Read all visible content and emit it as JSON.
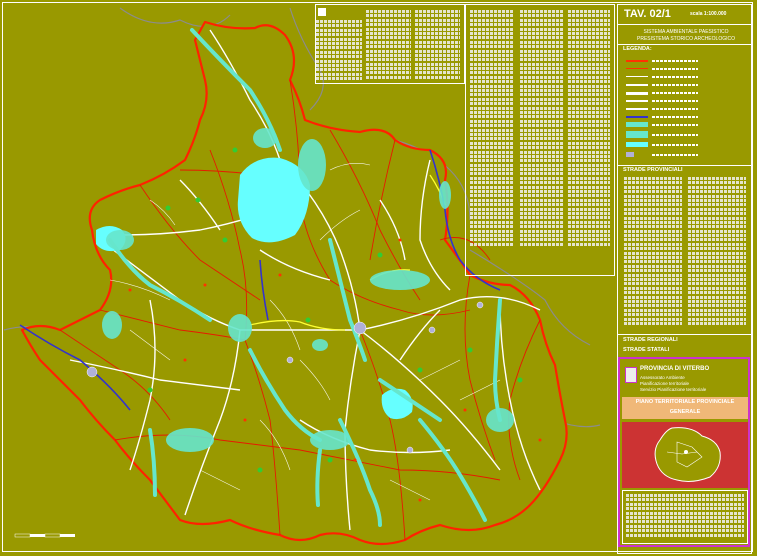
{
  "tav": "TAV. 02/1",
  "scala": "scala 1:100.000",
  "subtitle1": "SISTEMA AMBIENTALE PAESISTICO",
  "subtitle2": "PRESISTEMA STORICO ARCHEOLOGICO",
  "legenda": "LEGENDA:",
  "strade_provinciali": "STRADE PROVINCIALI",
  "strade_regionali": "STRADE REGIONALI",
  "strade_statali": "STRADE STATALI",
  "provincia": "PROVINCIA DI VITERBO",
  "provincia_sub1": "Assessorato Ambiente",
  "provincia_sub2": "Pianificazione territoriale",
  "provincia_sub3": "Servizio Pianificazione territoriale",
  "piano1": "PIANO TERRITORIALE PROVINCIALE",
  "piano2": "GENERALE",
  "colors": {
    "background": "#999900",
    "boundary": "#ff3300",
    "roads": "#ffffff",
    "water": "#66ffff",
    "rivers": "#3333cc",
    "provincial_highlight": "#ffff33",
    "frame_accent": "#cc33cc",
    "piano_box": "#f0b878"
  }
}
